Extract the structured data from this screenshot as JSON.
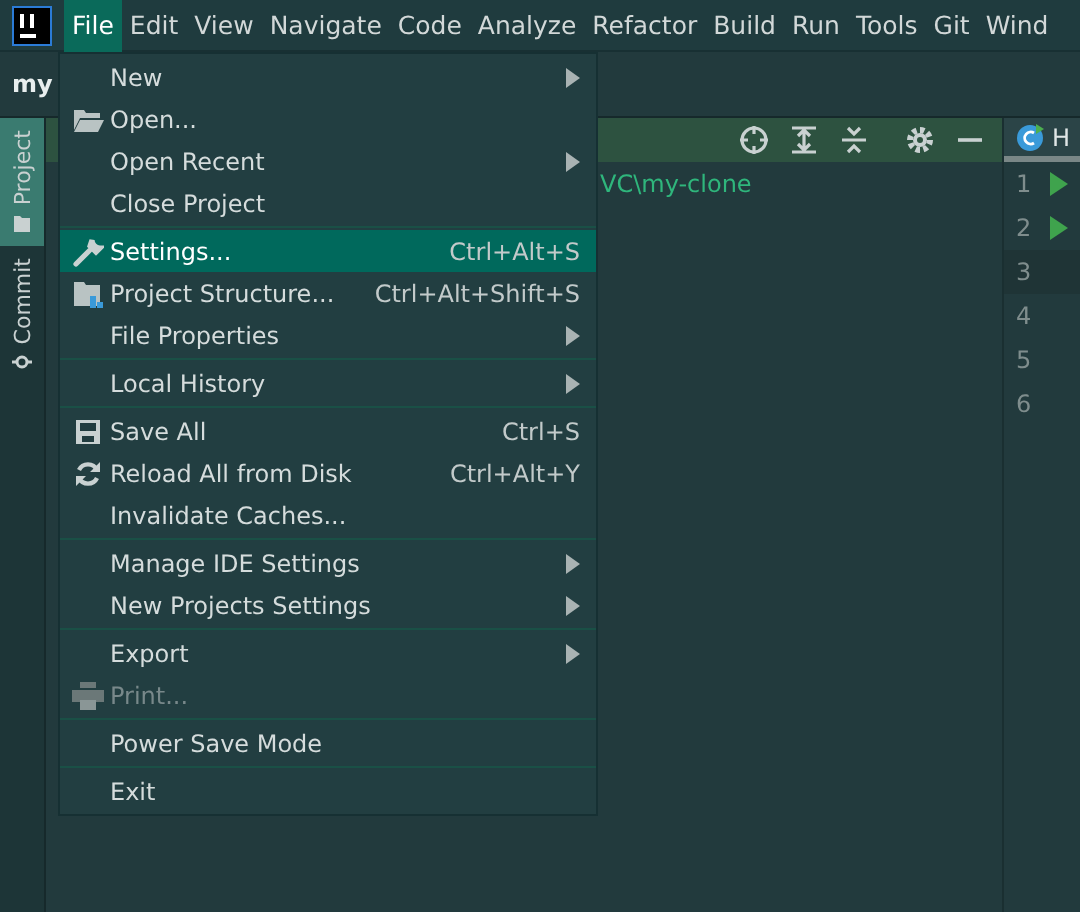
{
  "menu_bar": [
    {
      "label": "File",
      "selected": true
    },
    {
      "label": "Edit",
      "selected": false
    },
    {
      "label": "View",
      "selected": false
    },
    {
      "label": "Navigate",
      "selected": false
    },
    {
      "label": "Code",
      "selected": false
    },
    {
      "label": "Analyze",
      "selected": false
    },
    {
      "label": "Refactor",
      "selected": false
    },
    {
      "label": "Build",
      "selected": false
    },
    {
      "label": "Run",
      "selected": false
    },
    {
      "label": "Tools",
      "selected": false
    },
    {
      "label": "Git",
      "selected": false
    },
    {
      "label": "Wind",
      "selected": false
    }
  ],
  "project_title": "my",
  "tool_stripe": [
    {
      "label": "Project",
      "selected": true
    },
    {
      "label": "Commit",
      "selected": false
    }
  ],
  "project_panel": {
    "path": "VC\\my-clone"
  },
  "editor": {
    "tab": "H",
    "lines": [
      {
        "number": "1",
        "run": true,
        "current": false
      },
      {
        "number": "2",
        "run": true,
        "current": false
      },
      {
        "number": "3",
        "run": false,
        "current": true
      },
      {
        "number": "4",
        "run": false,
        "current": false
      },
      {
        "number": "5",
        "run": false,
        "current": false
      },
      {
        "number": "6",
        "run": false,
        "current": false
      }
    ]
  },
  "file_menu": [
    {
      "kind": "item",
      "label": "New",
      "submenu": true,
      "selected": false,
      "disabled": false
    },
    {
      "kind": "item",
      "label": "Open...",
      "submenu": false,
      "selected": false,
      "disabled": false
    },
    {
      "kind": "item",
      "label": "Open Recent",
      "submenu": true,
      "selected": false,
      "disabled": false
    },
    {
      "kind": "item",
      "label": "Close Project",
      "submenu": false,
      "selected": false,
      "disabled": false
    },
    {
      "kind": "separator"
    },
    {
      "kind": "item",
      "label": "Settings...",
      "shortcut": "Ctrl+Alt+S",
      "submenu": false,
      "selected": true,
      "disabled": false
    },
    {
      "kind": "item",
      "label": "Project Structure...",
      "shortcut": "Ctrl+Alt+Shift+S",
      "submenu": false,
      "selected": false,
      "disabled": false
    },
    {
      "kind": "item",
      "label": "File Properties",
      "submenu": true,
      "selected": false,
      "disabled": false
    },
    {
      "kind": "separator"
    },
    {
      "kind": "item",
      "label": "Local History",
      "submenu": true,
      "selected": false,
      "disabled": false
    },
    {
      "kind": "separator"
    },
    {
      "kind": "item",
      "label": "Save All",
      "shortcut": "Ctrl+S",
      "submenu": false,
      "selected": false,
      "disabled": false
    },
    {
      "kind": "item",
      "label": "Reload All from Disk",
      "shortcut": "Ctrl+Alt+Y",
      "submenu": false,
      "selected": false,
      "disabled": false
    },
    {
      "kind": "item",
      "label": "Invalidate Caches...",
      "submenu": false,
      "selected": false,
      "disabled": false
    },
    {
      "kind": "separator"
    },
    {
      "kind": "item",
      "label": "Manage IDE Settings",
      "submenu": true,
      "selected": false,
      "disabled": false
    },
    {
      "kind": "item",
      "label": "New Projects Settings",
      "submenu": true,
      "selected": false,
      "disabled": false
    },
    {
      "kind": "separator"
    },
    {
      "kind": "item",
      "label": "Export",
      "submenu": true,
      "selected": false,
      "disabled": false
    },
    {
      "kind": "item",
      "label": "Print...",
      "submenu": false,
      "selected": false,
      "disabled": true
    },
    {
      "kind": "separator"
    },
    {
      "kind": "item",
      "label": "Power Save Mode",
      "submenu": false,
      "selected": false,
      "disabled": false
    },
    {
      "kind": "separator"
    },
    {
      "kind": "item",
      "label": "Exit",
      "submenu": false,
      "selected": false,
      "disabled": false
    }
  ]
}
